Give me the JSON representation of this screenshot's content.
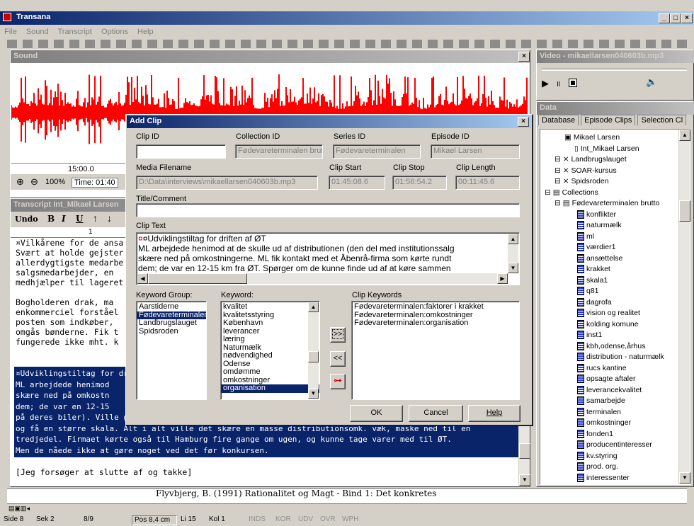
{
  "app": {
    "title": "Transana",
    "menu": [
      "File",
      "Sound",
      "Transcript",
      "Options",
      "Help"
    ]
  },
  "sound": {
    "title": "Sound",
    "time_mark": "15:00.0",
    "zoom": "100%",
    "time_label": "Time: 01:40"
  },
  "video": {
    "title": "Video - mikaellarsen040603b.mp3"
  },
  "data_panel": {
    "title": "Data",
    "tabs": [
      "Database",
      "Episode Clips",
      "Selection Cl"
    ],
    "tree_top": [
      {
        "label": "Mikael Larsen",
        "indent": 1
      },
      {
        "label": "Int_Mikael Larsen",
        "indent": 2
      },
      {
        "label": "Landbrugslauget",
        "indent": 0
      },
      {
        "label": "SOAR-kursus",
        "indent": 0
      },
      {
        "label": "Spidsroden",
        "indent": 0
      },
      {
        "label": "Collections",
        "indent": -1
      },
      {
        "label": "Fødevareterminalen brutto",
        "indent": 0
      }
    ],
    "clips": [
      "konflikter",
      "naturmælk",
      "ml",
      "værdier1",
      "ansættelse",
      "krakket",
      "skala1",
      "q81",
      "dagrofa",
      "vision og realitet",
      "kolding komune",
      "inst1",
      "kbh,odense,århus",
      "distribution - naturmælk",
      "rucs kantine",
      "opsagte aftaler",
      "leverancekvalitet",
      "samarbejde",
      "terminalen",
      "omkostninger",
      "fonden1",
      "producentinteresser",
      "kv.styring",
      "prod. org.",
      "interessenter"
    ]
  },
  "transcript": {
    "title": "Transcript Int_Mikael Larsen",
    "toolbar": {
      "undo": "Undo",
      "bold": "B",
      "italic": "I",
      "underline": "U"
    },
    "ruler_one": "1",
    "lines_top": [
      "¤Vilkårene for de ansa",
      "Svært at holde gejster",
      "allerdygtigste medarbe",
      "salgsmedarbejder, en",
      "medhjælper til lageret",
      "",
      "Bogholderen drak, ma",
      "enkommerciel forståel",
      "posten som indkøber,",
      "omgås bønderne. Fik t",
      "fungerede ikke mht. k"
    ],
    "lines_hl": [
      "¤Udviklingstiltag for dr",
      "ML arbejdede henimod",
      "skære ned på omkostn",
      "dem; de var en 12-15",
      "på deres biler). Ville gi",
      "og få en større skala. Alt i alt ville det skære en masse distributionsomk. væk, måske ned til en",
      "tredjedel. Firmaet kørte også til Hamburg fire gange om ugen, og kunne tage varer med til ØT.",
      "Men de nåede ikke at gøre noget ved det før konkursen."
    ],
    "last_line": "[Jeg forsøger at slutte af og takke]"
  },
  "bottom_line": "Flyvbjerg, B. (1991) Rationalitet og Magt - Bind 1: Det konkretes",
  "dialog": {
    "title": "Add Clip",
    "clip_id_label": "Clip ID",
    "clip_id": "",
    "collection_id_label": "Collection ID",
    "collection_id": "Fødevareterminalen brutto",
    "series_id_label": "Series ID",
    "series_id": "Fødevareterminalen",
    "episode_id_label": "Episode ID",
    "episode_id": "Mikael Larsen",
    "media_label": "Media Filename",
    "media": "D:\\Data\\interviews\\mikaellarsen040603b.mp3",
    "start_label": "Clip Start",
    "start": "01:45:08.6",
    "stop_label": "Clip Stop",
    "stop": "01:56:54.2",
    "length_label": "Clip Length",
    "length": "00:11:45.6",
    "title_label": "Title/Comment",
    "title_value": "",
    "text_label": "Clip Text",
    "text_lines": [
      "¤Udviklingstiltag for driften af ØT",
      "ML arbejdede henimod at de skulle ud af distributionen (den del med institutionssalg",
      "skære ned på omkostningerne. ML fik kontakt med et Åbenrå-firma som kørte rundt",
      "dem; de var en 12-15 km fra ØT. Spørger om de kunne finde ud af at køre sammen"
    ],
    "kwgroup_label": "Keyword Group:",
    "kwgroups": [
      "Aarstiderne",
      "Fødevareterminalen",
      "Landbrugslauget",
      "Spidsroden"
    ],
    "kwgroup_selected": 1,
    "keyword_label": "Keyword:",
    "keywords": [
      "kvalitet",
      "kvalitetsstyring",
      "København",
      "leverancer",
      "læring",
      "Naturmælk",
      "nødvendighed",
      "Odense",
      "omdømme",
      "omkostninger",
      "organisation"
    ],
    "keyword_selected": 10,
    "clipkw_label": "Clip Keywords",
    "clip_keywords": [
      "Fødevareterminalen:faktorer i krakket",
      "Fødevareterminalen:omkostninger",
      "Fødevareterminalen:organisation"
    ],
    "add_btn": ">>",
    "remove_btn": "<<",
    "ok": "OK",
    "cancel": "Cancel",
    "help": "Help"
  },
  "status": {
    "side": "Side 8",
    "sek": "Sek 2",
    "pages": "8/9",
    "pos": "Pos 8,4 cm",
    "li": "Li 15",
    "kol": "Kol 1",
    "modes": [
      "INDS",
      "KOR",
      "UDV",
      "OVR",
      "WPH"
    ]
  }
}
